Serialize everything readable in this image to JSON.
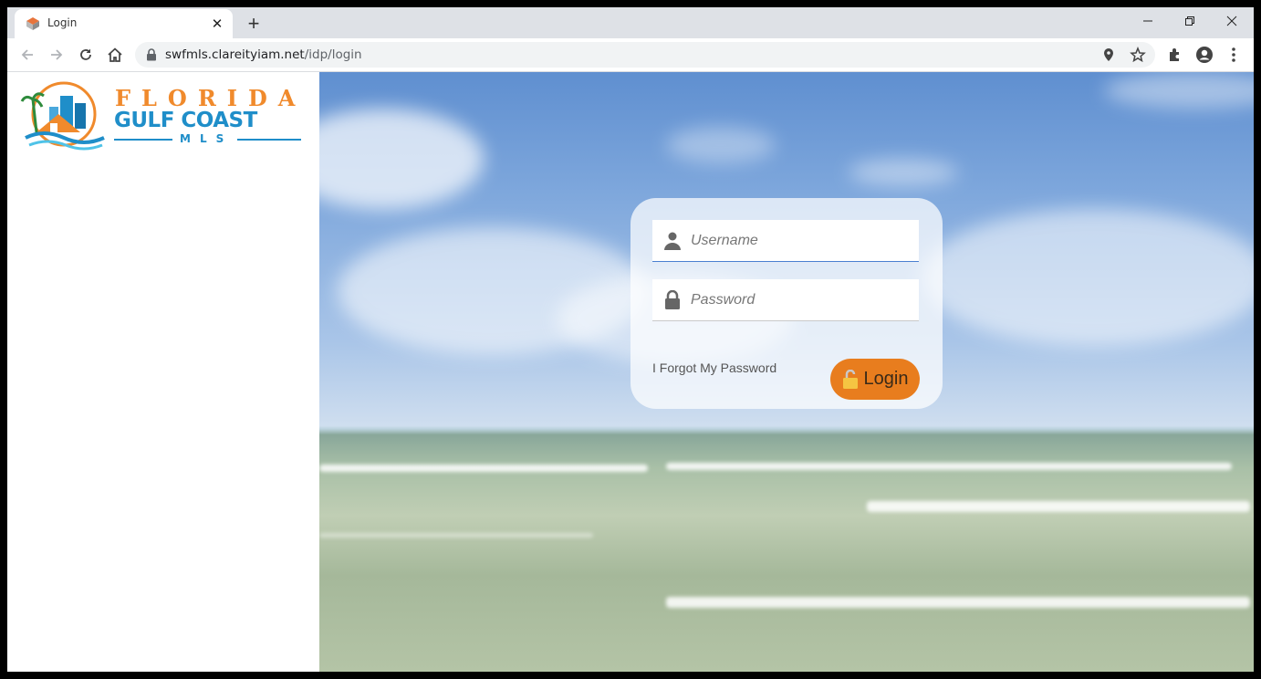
{
  "browser": {
    "tab_title": "Login",
    "url_host": "swfmls.clareityiam.net",
    "url_path": "/idp/login"
  },
  "logo": {
    "line1": "FLORIDA",
    "line2": "GULF COAST",
    "line3": "MLS"
  },
  "login": {
    "username_placeholder": "Username",
    "password_placeholder": "Password",
    "forgot_label": "I Forgot My Password",
    "button_label": "Login"
  },
  "colors": {
    "brand_orange": "#e87d1e",
    "brand_blue": "#1f8ec9"
  }
}
